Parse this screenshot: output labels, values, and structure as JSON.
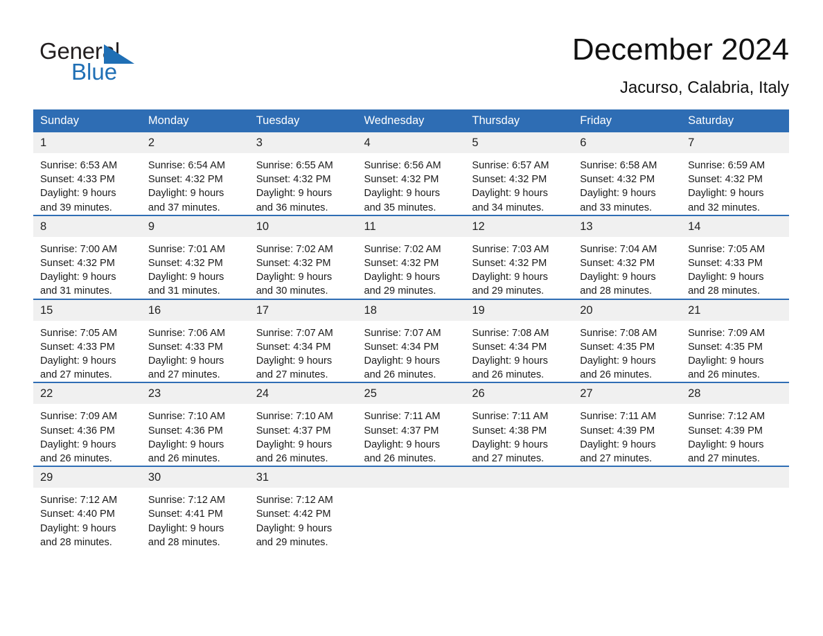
{
  "brand": {
    "name_part1": "General",
    "name_part2": "Blue",
    "triangle_color": "#1f6fb5",
    "accent_color": "#2e6db4"
  },
  "header": {
    "title": "December 2024",
    "location": "Jacurso, Calabria, Italy"
  },
  "calendar": {
    "weekday_headers": [
      "Sunday",
      "Monday",
      "Tuesday",
      "Wednesday",
      "Thursday",
      "Friday",
      "Saturday"
    ],
    "weeks": [
      [
        {
          "day": "1",
          "sunrise": "Sunrise: 6:53 AM",
          "sunset": "Sunset: 4:33 PM",
          "daylight_line1": "Daylight: 9 hours",
          "daylight_line2": "and 39 minutes."
        },
        {
          "day": "2",
          "sunrise": "Sunrise: 6:54 AM",
          "sunset": "Sunset: 4:32 PM",
          "daylight_line1": "Daylight: 9 hours",
          "daylight_line2": "and 37 minutes."
        },
        {
          "day": "3",
          "sunrise": "Sunrise: 6:55 AM",
          "sunset": "Sunset: 4:32 PM",
          "daylight_line1": "Daylight: 9 hours",
          "daylight_line2": "and 36 minutes."
        },
        {
          "day": "4",
          "sunrise": "Sunrise: 6:56 AM",
          "sunset": "Sunset: 4:32 PM",
          "daylight_line1": "Daylight: 9 hours",
          "daylight_line2": "and 35 minutes."
        },
        {
          "day": "5",
          "sunrise": "Sunrise: 6:57 AM",
          "sunset": "Sunset: 4:32 PM",
          "daylight_line1": "Daylight: 9 hours",
          "daylight_line2": "and 34 minutes."
        },
        {
          "day": "6",
          "sunrise": "Sunrise: 6:58 AM",
          "sunset": "Sunset: 4:32 PM",
          "daylight_line1": "Daylight: 9 hours",
          "daylight_line2": "and 33 minutes."
        },
        {
          "day": "7",
          "sunrise": "Sunrise: 6:59 AM",
          "sunset": "Sunset: 4:32 PM",
          "daylight_line1": "Daylight: 9 hours",
          "daylight_line2": "and 32 minutes."
        }
      ],
      [
        {
          "day": "8",
          "sunrise": "Sunrise: 7:00 AM",
          "sunset": "Sunset: 4:32 PM",
          "daylight_line1": "Daylight: 9 hours",
          "daylight_line2": "and 31 minutes."
        },
        {
          "day": "9",
          "sunrise": "Sunrise: 7:01 AM",
          "sunset": "Sunset: 4:32 PM",
          "daylight_line1": "Daylight: 9 hours",
          "daylight_line2": "and 31 minutes."
        },
        {
          "day": "10",
          "sunrise": "Sunrise: 7:02 AM",
          "sunset": "Sunset: 4:32 PM",
          "daylight_line1": "Daylight: 9 hours",
          "daylight_line2": "and 30 minutes."
        },
        {
          "day": "11",
          "sunrise": "Sunrise: 7:02 AM",
          "sunset": "Sunset: 4:32 PM",
          "daylight_line1": "Daylight: 9 hours",
          "daylight_line2": "and 29 minutes."
        },
        {
          "day": "12",
          "sunrise": "Sunrise: 7:03 AM",
          "sunset": "Sunset: 4:32 PM",
          "daylight_line1": "Daylight: 9 hours",
          "daylight_line2": "and 29 minutes."
        },
        {
          "day": "13",
          "sunrise": "Sunrise: 7:04 AM",
          "sunset": "Sunset: 4:32 PM",
          "daylight_line1": "Daylight: 9 hours",
          "daylight_line2": "and 28 minutes."
        },
        {
          "day": "14",
          "sunrise": "Sunrise: 7:05 AM",
          "sunset": "Sunset: 4:33 PM",
          "daylight_line1": "Daylight: 9 hours",
          "daylight_line2": "and 28 minutes."
        }
      ],
      [
        {
          "day": "15",
          "sunrise": "Sunrise: 7:05 AM",
          "sunset": "Sunset: 4:33 PM",
          "daylight_line1": "Daylight: 9 hours",
          "daylight_line2": "and 27 minutes."
        },
        {
          "day": "16",
          "sunrise": "Sunrise: 7:06 AM",
          "sunset": "Sunset: 4:33 PM",
          "daylight_line1": "Daylight: 9 hours",
          "daylight_line2": "and 27 minutes."
        },
        {
          "day": "17",
          "sunrise": "Sunrise: 7:07 AM",
          "sunset": "Sunset: 4:34 PM",
          "daylight_line1": "Daylight: 9 hours",
          "daylight_line2": "and 27 minutes."
        },
        {
          "day": "18",
          "sunrise": "Sunrise: 7:07 AM",
          "sunset": "Sunset: 4:34 PM",
          "daylight_line1": "Daylight: 9 hours",
          "daylight_line2": "and 26 minutes."
        },
        {
          "day": "19",
          "sunrise": "Sunrise: 7:08 AM",
          "sunset": "Sunset: 4:34 PM",
          "daylight_line1": "Daylight: 9 hours",
          "daylight_line2": "and 26 minutes."
        },
        {
          "day": "20",
          "sunrise": "Sunrise: 7:08 AM",
          "sunset": "Sunset: 4:35 PM",
          "daylight_line1": "Daylight: 9 hours",
          "daylight_line2": "and 26 minutes."
        },
        {
          "day": "21",
          "sunrise": "Sunrise: 7:09 AM",
          "sunset": "Sunset: 4:35 PM",
          "daylight_line1": "Daylight: 9 hours",
          "daylight_line2": "and 26 minutes."
        }
      ],
      [
        {
          "day": "22",
          "sunrise": "Sunrise: 7:09 AM",
          "sunset": "Sunset: 4:36 PM",
          "daylight_line1": "Daylight: 9 hours",
          "daylight_line2": "and 26 minutes."
        },
        {
          "day": "23",
          "sunrise": "Sunrise: 7:10 AM",
          "sunset": "Sunset: 4:36 PM",
          "daylight_line1": "Daylight: 9 hours",
          "daylight_line2": "and 26 minutes."
        },
        {
          "day": "24",
          "sunrise": "Sunrise: 7:10 AM",
          "sunset": "Sunset: 4:37 PM",
          "daylight_line1": "Daylight: 9 hours",
          "daylight_line2": "and 26 minutes."
        },
        {
          "day": "25",
          "sunrise": "Sunrise: 7:11 AM",
          "sunset": "Sunset: 4:37 PM",
          "daylight_line1": "Daylight: 9 hours",
          "daylight_line2": "and 26 minutes."
        },
        {
          "day": "26",
          "sunrise": "Sunrise: 7:11 AM",
          "sunset": "Sunset: 4:38 PM",
          "daylight_line1": "Daylight: 9 hours",
          "daylight_line2": "and 27 minutes."
        },
        {
          "day": "27",
          "sunrise": "Sunrise: 7:11 AM",
          "sunset": "Sunset: 4:39 PM",
          "daylight_line1": "Daylight: 9 hours",
          "daylight_line2": "and 27 minutes."
        },
        {
          "day": "28",
          "sunrise": "Sunrise: 7:12 AM",
          "sunset": "Sunset: 4:39 PM",
          "daylight_line1": "Daylight: 9 hours",
          "daylight_line2": "and 27 minutes."
        }
      ],
      [
        {
          "day": "29",
          "sunrise": "Sunrise: 7:12 AM",
          "sunset": "Sunset: 4:40 PM",
          "daylight_line1": "Daylight: 9 hours",
          "daylight_line2": "and 28 minutes."
        },
        {
          "day": "30",
          "sunrise": "Sunrise: 7:12 AM",
          "sunset": "Sunset: 4:41 PM",
          "daylight_line1": "Daylight: 9 hours",
          "daylight_line2": "and 28 minutes."
        },
        {
          "day": "31",
          "sunrise": "Sunrise: 7:12 AM",
          "sunset": "Sunset: 4:42 PM",
          "daylight_line1": "Daylight: 9 hours",
          "daylight_line2": "and 29 minutes."
        },
        {
          "day": "",
          "sunrise": "",
          "sunset": "",
          "daylight_line1": "",
          "daylight_line2": ""
        },
        {
          "day": "",
          "sunrise": "",
          "sunset": "",
          "daylight_line1": "",
          "daylight_line2": ""
        },
        {
          "day": "",
          "sunrise": "",
          "sunset": "",
          "daylight_line1": "",
          "daylight_line2": ""
        },
        {
          "day": "",
          "sunrise": "",
          "sunset": "",
          "daylight_line1": "",
          "daylight_line2": ""
        }
      ]
    ]
  }
}
